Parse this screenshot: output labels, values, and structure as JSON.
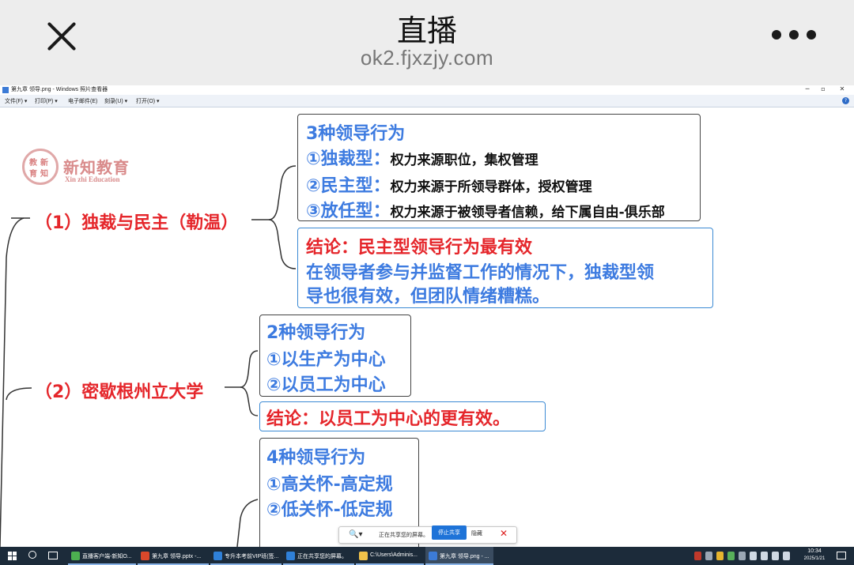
{
  "app": {
    "title": "直播",
    "url": "ok2.fjxzjy.com"
  },
  "window": {
    "title": "第九章 领导.png - Windows 照片查看器",
    "controls": {
      "minimize": "─",
      "maximize": "▫",
      "close": "✕"
    },
    "menu": [
      "文件(F) ▾",
      "打印(P) ▾",
      "电子邮件(E)",
      "刻录(U) ▾",
      "打开(O) ▾"
    ],
    "help": "?"
  },
  "logo": {
    "seal": [
      "教",
      "新",
      "育",
      "知"
    ],
    "name": "新知教育",
    "sub": "Xin zhi Education"
  },
  "mindmap": {
    "branch1": {
      "label": "（1）独裁与民主（勒温）",
      "box1": {
        "head": "3种领导行为",
        "rows": [
          {
            "key": "①独裁型：",
            "text": "权力来源职位，集权管理"
          },
          {
            "key": "②民主型：",
            "text": "权力来源于所领导群体，授权管理"
          },
          {
            "key": "③放任型：",
            "text": "权力来源于被领导者信赖，给下属自由-俱乐部"
          }
        ]
      },
      "box2": {
        "head": "结论：民主型领导行为最有效",
        "line1": "在领导者参与并监督工作的情况下，独裁型领",
        "line2": "导也很有效，但团队情绪糟糕。"
      }
    },
    "branch2": {
      "label": "（2）密歇根州立大学",
      "box1": {
        "head": "2种领导行为",
        "line1": "①以生产为中心",
        "line2": "②以员工为中心"
      },
      "box2": {
        "head": "结论：以员工为中心的更有效。"
      }
    },
    "branch3": {
      "box1": {
        "head": "4种领导行为",
        "line1": "①高关怀-高定规",
        "line2": "②低关怀-低定规"
      }
    }
  },
  "share": {
    "search": "🔍▾",
    "text": "正在共享您的屏幕。",
    "stop": "停止共享",
    "hide": "隐藏",
    "close": "✕"
  },
  "taskbar": {
    "apps": [
      {
        "label": "直播客户端-新知O...",
        "color": "#4caf50"
      },
      {
        "label": "第九章 领导.pptx -...",
        "color": "#d9482b"
      },
      {
        "label": "专升本考前VIP班(签...",
        "color": "#2f80d8"
      },
      {
        "label": "正在共享您的屏幕。",
        "color": "#2f80d8"
      },
      {
        "label": "C:\\Users\\Adminis...",
        "color": "#f0c24a"
      },
      {
        "label": "第九章 领导.png - ...",
        "color": "#3c7bd6"
      }
    ],
    "time": "10:34",
    "date": "2025/1/21"
  }
}
